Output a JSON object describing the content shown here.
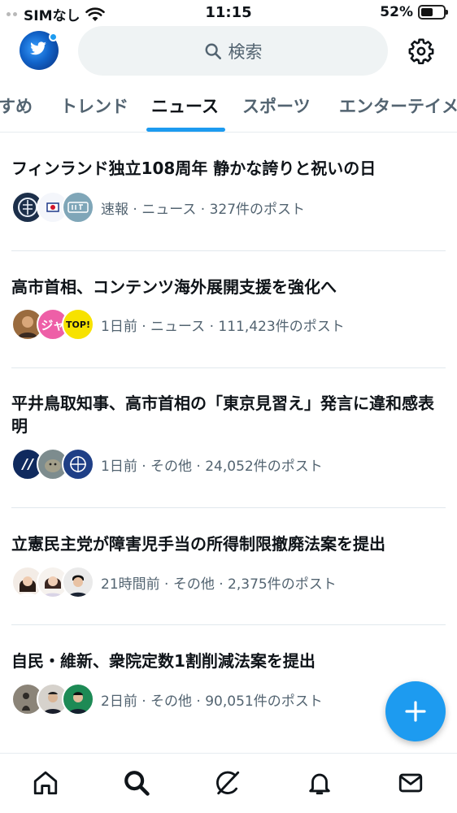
{
  "status_bar": {
    "carrier": "SIMなし",
    "time": "11:15",
    "battery_percent": "52%",
    "battery_level": 0.52,
    "icons": [
      "wifi-icon",
      "battery-icon"
    ]
  },
  "header": {
    "search_placeholder": "検索",
    "icons": [
      "search-icon",
      "gear-icon"
    ]
  },
  "tabs": [
    {
      "label": "すめ"
    },
    {
      "label": "トレンド"
    },
    {
      "label": "ニュース",
      "active": true
    },
    {
      "label": "スポーツ"
    },
    {
      "label": "エンターテイメ"
    }
  ],
  "news": [
    {
      "title": "フィンランド独立108周年 静かな誇りと祝いの日",
      "meta": "速報 · ニュース · 327件のポスト"
    },
    {
      "title": "高市首相、コンテンツ海外展開支援を強化へ",
      "meta": "1日前 · ニュース · 111,423件のポスト",
      "avatar_text": [
        "ジャ",
        "TOP!"
      ]
    },
    {
      "title": "平井鳥取知事、高市首相の「東京見習え」発言に違和感表明",
      "meta": "1日前 · その他 · 24,052件のポスト"
    },
    {
      "title": "立憲民主党が障害児手当の所得制限撤廃法案を提出",
      "meta": "21時間前 · その他 · 2,375件のポスト"
    },
    {
      "title": "自民・維新、衆院定数1割削減法案を提出",
      "meta": "2日前 · その他 · 90,051件のポスト"
    }
  ],
  "fab": {
    "icon": "plus-icon"
  },
  "bottom_nav": {
    "items": [
      "home-icon",
      "search-icon",
      "grok-icon",
      "bell-icon",
      "mail-icon"
    ]
  },
  "colors": {
    "accent": "#1d9bf0",
    "text_primary": "#0f1419",
    "text_secondary": "#536471",
    "search_bg": "#eff3f4"
  }
}
